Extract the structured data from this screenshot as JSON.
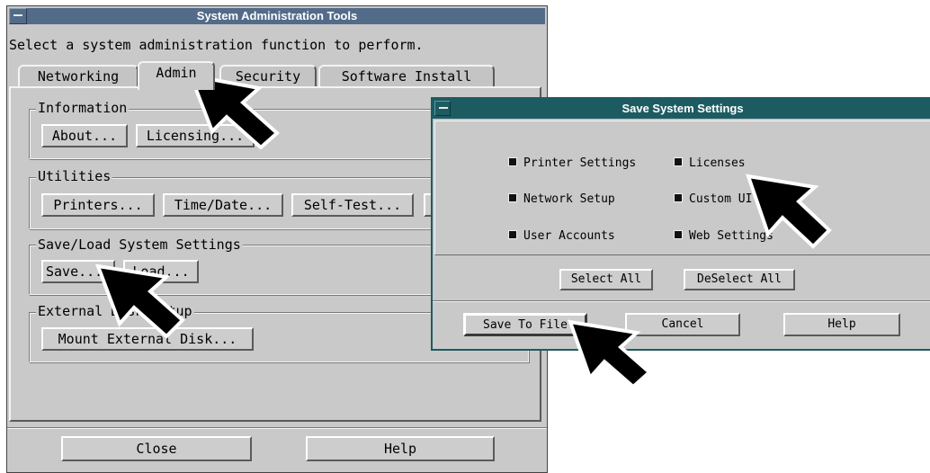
{
  "main_window": {
    "title": "System Administration Tools",
    "instruction": "Select a system administration function to perform.",
    "tabs": [
      "Networking",
      "Admin",
      "Security",
      "Software Install"
    ],
    "groups": {
      "information": {
        "label": "Information",
        "about": "About...",
        "licensing": "Licensing..."
      },
      "utilities": {
        "label": "Utilities",
        "printers": "Printers...",
        "time_date": "Time/Date...",
        "self_test": "Self-Test..."
      },
      "save_load": {
        "label": "Save/Load System Settings",
        "save": "Save...",
        "load": "Load..."
      },
      "external": {
        "label": "External Disk Setup",
        "mount": "Mount External Disk..."
      }
    },
    "close": "Close",
    "help": "Help"
  },
  "dialog": {
    "title": "Save System Settings",
    "checkboxes": [
      "Printer Settings",
      "Licenses",
      "Network Setup",
      "Custom UI",
      "User Accounts",
      "Web Settings"
    ],
    "select_all": "Select All",
    "deselect_all": "DeSelect All",
    "save_to_file": "Save To File",
    "cancel": "Cancel",
    "help": "Help"
  },
  "colors": {
    "main_titlebar": "#516b89",
    "dialog_titlebar": "#1d5b62",
    "window_bg": "#c9c9c9"
  }
}
